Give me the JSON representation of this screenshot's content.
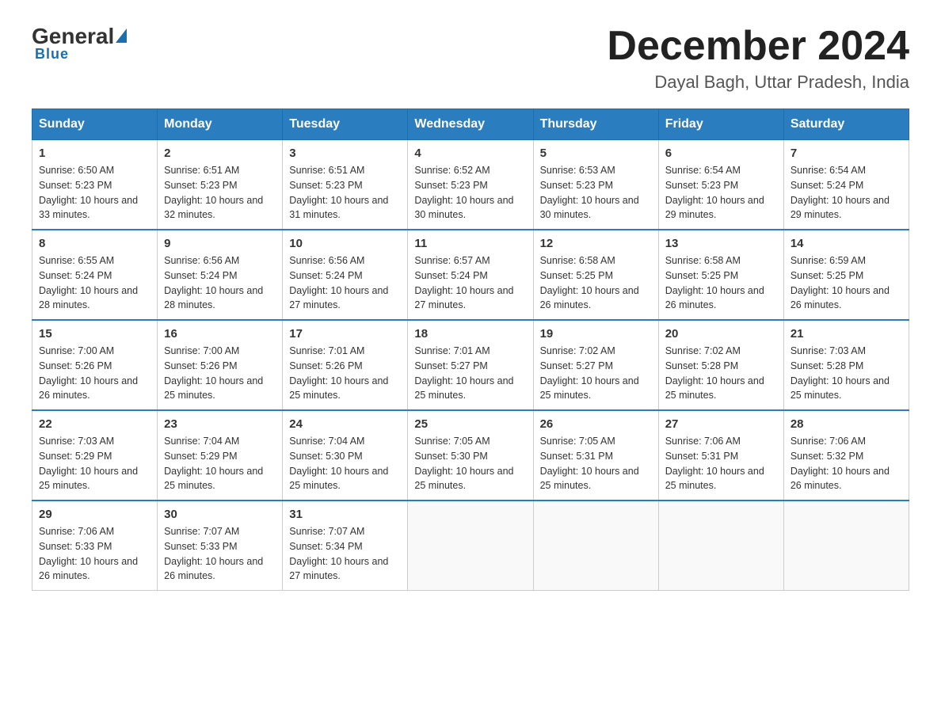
{
  "header": {
    "logo": {
      "general": "General",
      "blue": "Blue",
      "underline": "Blue"
    },
    "title": "December 2024",
    "subtitle": "Dayal Bagh, Uttar Pradesh, India"
  },
  "calendar": {
    "days_of_week": [
      "Sunday",
      "Monday",
      "Tuesday",
      "Wednesday",
      "Thursday",
      "Friday",
      "Saturday"
    ],
    "weeks": [
      [
        {
          "day": "1",
          "sunrise": "6:50 AM",
          "sunset": "5:23 PM",
          "daylight": "10 hours and 33 minutes."
        },
        {
          "day": "2",
          "sunrise": "6:51 AM",
          "sunset": "5:23 PM",
          "daylight": "10 hours and 32 minutes."
        },
        {
          "day": "3",
          "sunrise": "6:51 AM",
          "sunset": "5:23 PM",
          "daylight": "10 hours and 31 minutes."
        },
        {
          "day": "4",
          "sunrise": "6:52 AM",
          "sunset": "5:23 PM",
          "daylight": "10 hours and 30 minutes."
        },
        {
          "day": "5",
          "sunrise": "6:53 AM",
          "sunset": "5:23 PM",
          "daylight": "10 hours and 30 minutes."
        },
        {
          "day": "6",
          "sunrise": "6:54 AM",
          "sunset": "5:23 PM",
          "daylight": "10 hours and 29 minutes."
        },
        {
          "day": "7",
          "sunrise": "6:54 AM",
          "sunset": "5:24 PM",
          "daylight": "10 hours and 29 minutes."
        }
      ],
      [
        {
          "day": "8",
          "sunrise": "6:55 AM",
          "sunset": "5:24 PM",
          "daylight": "10 hours and 28 minutes."
        },
        {
          "day": "9",
          "sunrise": "6:56 AM",
          "sunset": "5:24 PM",
          "daylight": "10 hours and 28 minutes."
        },
        {
          "day": "10",
          "sunrise": "6:56 AM",
          "sunset": "5:24 PM",
          "daylight": "10 hours and 27 minutes."
        },
        {
          "day": "11",
          "sunrise": "6:57 AM",
          "sunset": "5:24 PM",
          "daylight": "10 hours and 27 minutes."
        },
        {
          "day": "12",
          "sunrise": "6:58 AM",
          "sunset": "5:25 PM",
          "daylight": "10 hours and 26 minutes."
        },
        {
          "day": "13",
          "sunrise": "6:58 AM",
          "sunset": "5:25 PM",
          "daylight": "10 hours and 26 minutes."
        },
        {
          "day": "14",
          "sunrise": "6:59 AM",
          "sunset": "5:25 PM",
          "daylight": "10 hours and 26 minutes."
        }
      ],
      [
        {
          "day": "15",
          "sunrise": "7:00 AM",
          "sunset": "5:26 PM",
          "daylight": "10 hours and 26 minutes."
        },
        {
          "day": "16",
          "sunrise": "7:00 AM",
          "sunset": "5:26 PM",
          "daylight": "10 hours and 25 minutes."
        },
        {
          "day": "17",
          "sunrise": "7:01 AM",
          "sunset": "5:26 PM",
          "daylight": "10 hours and 25 minutes."
        },
        {
          "day": "18",
          "sunrise": "7:01 AM",
          "sunset": "5:27 PM",
          "daylight": "10 hours and 25 minutes."
        },
        {
          "day": "19",
          "sunrise": "7:02 AM",
          "sunset": "5:27 PM",
          "daylight": "10 hours and 25 minutes."
        },
        {
          "day": "20",
          "sunrise": "7:02 AM",
          "sunset": "5:28 PM",
          "daylight": "10 hours and 25 minutes."
        },
        {
          "day": "21",
          "sunrise": "7:03 AM",
          "sunset": "5:28 PM",
          "daylight": "10 hours and 25 minutes."
        }
      ],
      [
        {
          "day": "22",
          "sunrise": "7:03 AM",
          "sunset": "5:29 PM",
          "daylight": "10 hours and 25 minutes."
        },
        {
          "day": "23",
          "sunrise": "7:04 AM",
          "sunset": "5:29 PM",
          "daylight": "10 hours and 25 minutes."
        },
        {
          "day": "24",
          "sunrise": "7:04 AM",
          "sunset": "5:30 PM",
          "daylight": "10 hours and 25 minutes."
        },
        {
          "day": "25",
          "sunrise": "7:05 AM",
          "sunset": "5:30 PM",
          "daylight": "10 hours and 25 minutes."
        },
        {
          "day": "26",
          "sunrise": "7:05 AM",
          "sunset": "5:31 PM",
          "daylight": "10 hours and 25 minutes."
        },
        {
          "day": "27",
          "sunrise": "7:06 AM",
          "sunset": "5:31 PM",
          "daylight": "10 hours and 25 minutes."
        },
        {
          "day": "28",
          "sunrise": "7:06 AM",
          "sunset": "5:32 PM",
          "daylight": "10 hours and 26 minutes."
        }
      ],
      [
        {
          "day": "29",
          "sunrise": "7:06 AM",
          "sunset": "5:33 PM",
          "daylight": "10 hours and 26 minutes."
        },
        {
          "day": "30",
          "sunrise": "7:07 AM",
          "sunset": "5:33 PM",
          "daylight": "10 hours and 26 minutes."
        },
        {
          "day": "31",
          "sunrise": "7:07 AM",
          "sunset": "5:34 PM",
          "daylight": "10 hours and 27 minutes."
        },
        null,
        null,
        null,
        null
      ]
    ]
  }
}
